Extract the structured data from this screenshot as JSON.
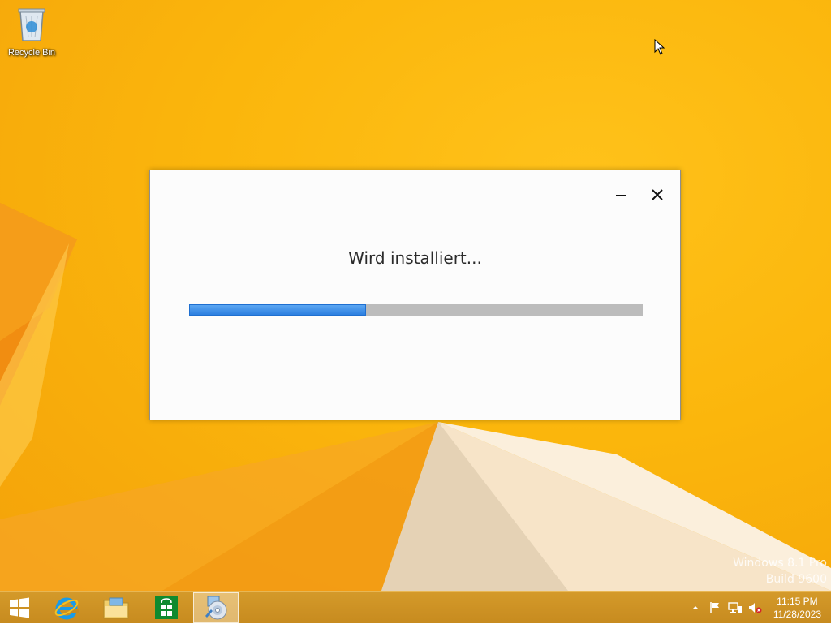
{
  "desktop": {
    "icons": [
      {
        "label": "Recycle Bin",
        "icon": "recycle-bin-icon"
      }
    ],
    "watermark": {
      "line1": "Windows 8.1 Pro",
      "line2": "Build 9600"
    }
  },
  "dialog": {
    "status_text": "Wird installiert...",
    "progress_fraction": 0.39,
    "buttons": {
      "minimize": "minimize-icon",
      "close": "close-icon"
    }
  },
  "taskbar": {
    "items": [
      {
        "name": "start",
        "icon": "windows-logo-icon"
      },
      {
        "name": "internet-explorer",
        "icon": "internet-explorer-icon"
      },
      {
        "name": "file-explorer",
        "icon": "folder-icon"
      },
      {
        "name": "store",
        "icon": "store-icon"
      },
      {
        "name": "setup",
        "icon": "setup-disc-icon",
        "active": true
      }
    ],
    "tray_icons": [
      "chevron-up-icon",
      "flag-icon",
      "network-icon",
      "volume-muted-icon"
    ],
    "clock": {
      "time": "11:15 PM",
      "date": "11/28/2023"
    }
  },
  "colors": {
    "accent_progress": "#2c7fe0",
    "wallpaper": "#fbb60c",
    "taskbar": "#c78b1f"
  }
}
